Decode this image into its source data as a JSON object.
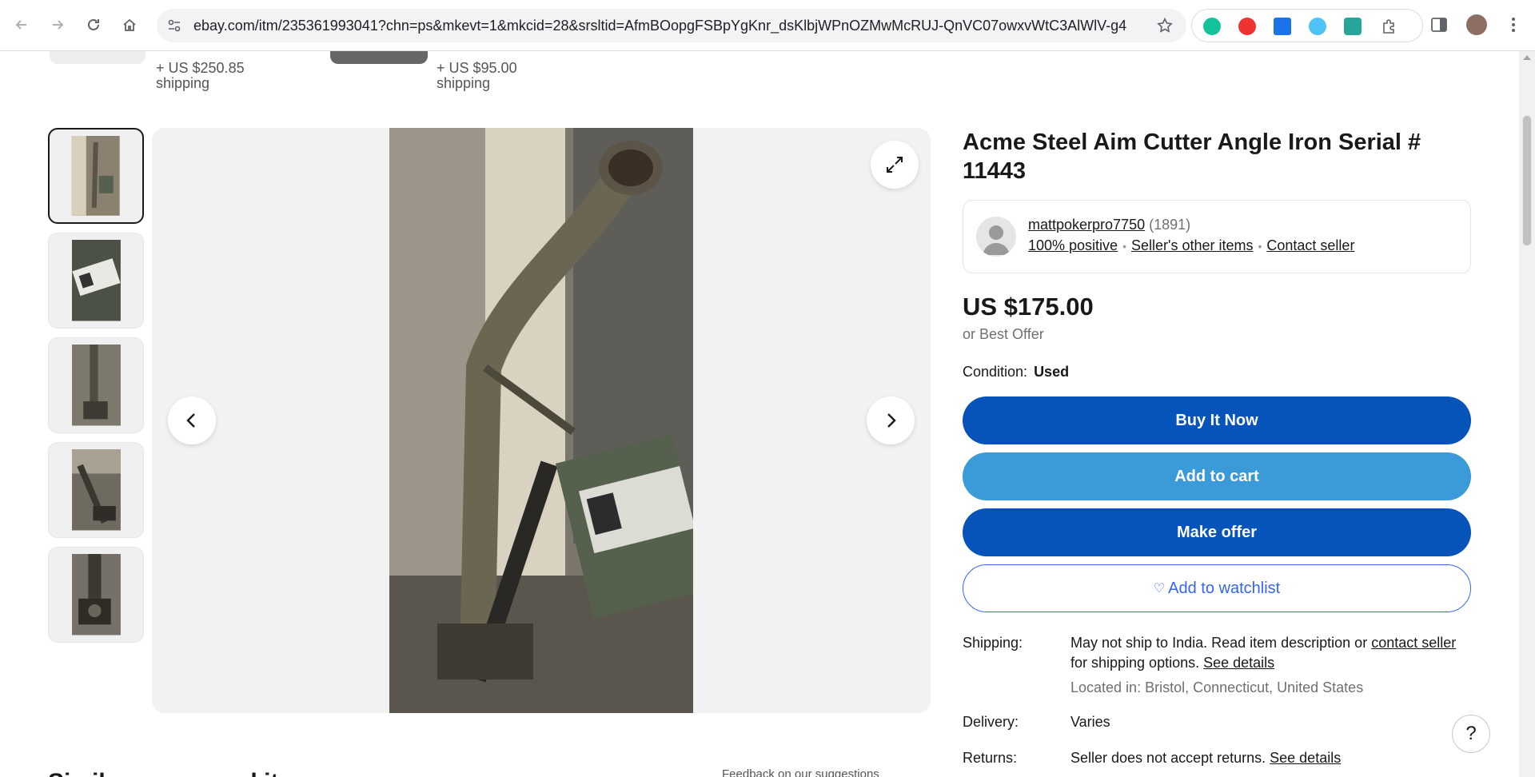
{
  "browser": {
    "url": "ebay.com/itm/235361993041?chn=ps&mkevt=1&mkcid=28&srsltid=AfmBOopgFSBpYgKnr_dsKlbjWPnOZMwMcRUJ-QnVC07owxvWtC3AlWlV-g4"
  },
  "related": {
    "items": [
      {
        "shipping_price": "+ US $250.85",
        "shipping_label": "shipping"
      },
      {
        "shipping_price": "+ US $95.00",
        "shipping_label": "shipping"
      }
    ]
  },
  "listing": {
    "title": "Acme Steel Aim Cutter Angle Iron Serial # 11443",
    "seller": {
      "name": "mattpokerpro7750",
      "feedback_count": "(1891)",
      "positive": "100% positive",
      "other_items": "Seller's other items",
      "contact": "Contact seller"
    },
    "price": "US $175.00",
    "best_offer": "or Best Offer",
    "condition_label": "Condition:",
    "condition_value": "Used",
    "buttons": {
      "buy": "Buy It Now",
      "cart": "Add to cart",
      "offer": "Make offer",
      "watch": "Add to watchlist"
    },
    "shipping": {
      "label": "Shipping:",
      "text_before": "May not ship to India. Read item description or ",
      "contact_link": "contact seller",
      "text_after": " for shipping options. ",
      "details_link": "See details",
      "located": "Located in: Bristol, Connecticut, United States"
    },
    "delivery": {
      "label": "Delivery:",
      "value": "Varies"
    },
    "returns": {
      "label": "Returns:",
      "text": "Seller does not accept returns. ",
      "details_link": "See details"
    }
  },
  "help": {
    "label": "?"
  },
  "similar": {
    "heading": "Similar sponsored items",
    "feedback": "Feedback on our suggestions"
  },
  "colors": {
    "primary": "#0654ba",
    "cart": "#3b9ad8",
    "link": "#3665f3"
  }
}
